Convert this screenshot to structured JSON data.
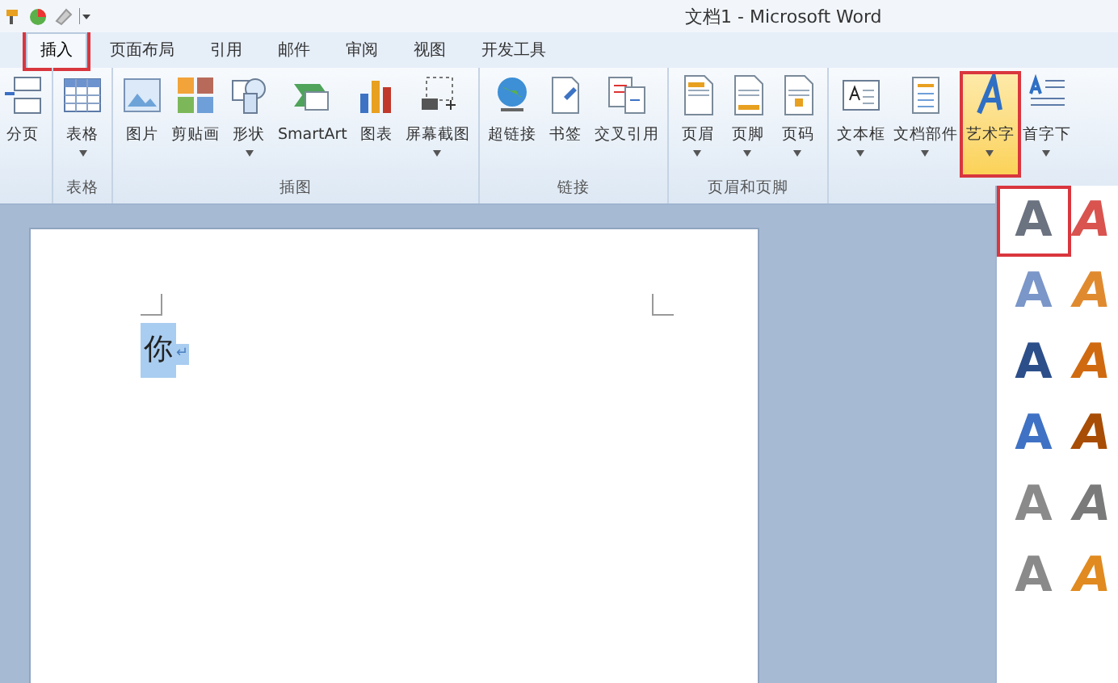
{
  "window": {
    "title": "文档1 - Microsoft Word"
  },
  "tabs": [
    {
      "label": "插入",
      "selected": true,
      "marked": true
    },
    {
      "label": "页面布局",
      "selected": false,
      "marked": false
    },
    {
      "label": "引用",
      "selected": false,
      "marked": false
    },
    {
      "label": "邮件",
      "selected": false,
      "marked": false
    },
    {
      "label": "审阅",
      "selected": false,
      "marked": false
    },
    {
      "label": "视图",
      "selected": false,
      "marked": false
    },
    {
      "label": "开发工具",
      "selected": false,
      "marked": false
    }
  ],
  "ribbon": {
    "groups": [
      {
        "buttons": [
          {
            "label": "分页",
            "dropdown": false,
            "selected": false,
            "marked": false
          }
        ]
      },
      {
        "label": "表格",
        "buttons": [
          {
            "label": "表格",
            "dropdown": true,
            "selected": false,
            "marked": false
          }
        ]
      },
      {
        "label": "插图",
        "buttons": [
          {
            "label": "图片",
            "dropdown": false,
            "selected": false,
            "marked": false
          },
          {
            "label": "剪贴画",
            "dropdown": false,
            "selected": false,
            "marked": false
          },
          {
            "label": "形状",
            "dropdown": true,
            "selected": false,
            "marked": false
          },
          {
            "label": "SmartArt",
            "dropdown": false,
            "selected": false,
            "marked": false
          },
          {
            "label": "图表",
            "dropdown": false,
            "selected": false,
            "marked": false
          },
          {
            "label": "屏幕截图",
            "dropdown": true,
            "selected": false,
            "marked": false
          }
        ]
      },
      {
        "label": "链接",
        "buttons": [
          {
            "label": "超链接",
            "dropdown": false,
            "selected": false,
            "marked": false
          },
          {
            "label": "书签",
            "dropdown": false,
            "selected": false,
            "marked": false
          },
          {
            "label": "交叉引用",
            "dropdown": false,
            "selected": false,
            "marked": false
          }
        ]
      },
      {
        "label": "页眉和页脚",
        "buttons": [
          {
            "label": "页眉",
            "dropdown": true,
            "selected": false,
            "marked": false
          },
          {
            "label": "页脚",
            "dropdown": true,
            "selected": false,
            "marked": false
          },
          {
            "label": "页码",
            "dropdown": true,
            "selected": false,
            "marked": false
          }
        ]
      },
      {
        "buttons": [
          {
            "label": "文本框",
            "dropdown": true,
            "selected": false,
            "marked": false
          },
          {
            "label": "文档部件",
            "dropdown": true,
            "selected": false,
            "marked": false
          },
          {
            "label": "艺术字",
            "dropdown": true,
            "selected": true,
            "marked": true
          },
          {
            "label": "首字下",
            "dropdown": true,
            "selected": false,
            "marked": false
          }
        ]
      }
    ]
  },
  "document": {
    "text": "你",
    "selected": true,
    "paragraph_mark": "↵"
  },
  "wordart_gallery": [
    [
      {
        "letter": "A",
        "color": "#6b7280",
        "selected": true
      },
      {
        "letter": "A",
        "color": "#d9534f",
        "selected": false
      }
    ],
    [
      {
        "letter": "A",
        "color": "#7b96c8",
        "selected": false
      },
      {
        "letter": "A",
        "color": "#e08a30",
        "selected": false
      }
    ],
    [
      {
        "letter": "A",
        "color": "#2c4f8a",
        "selected": false
      },
      {
        "letter": "A",
        "color": "#d06a10",
        "selected": false
      }
    ],
    [
      {
        "letter": "A",
        "color": "#3f72c4",
        "selected": false
      },
      {
        "letter": "A",
        "color": "#a84d05",
        "selected": false
      }
    ],
    [
      {
        "letter": "A",
        "color": "#8a8a8a",
        "selected": false
      },
      {
        "letter": "A",
        "color": "#7a7a7a",
        "selected": false
      }
    ],
    [
      {
        "letter": "A",
        "color": "#8a8a8a",
        "selected": false
      },
      {
        "letter": "A",
        "color": "#e08a20",
        "selected": false
      }
    ]
  ]
}
